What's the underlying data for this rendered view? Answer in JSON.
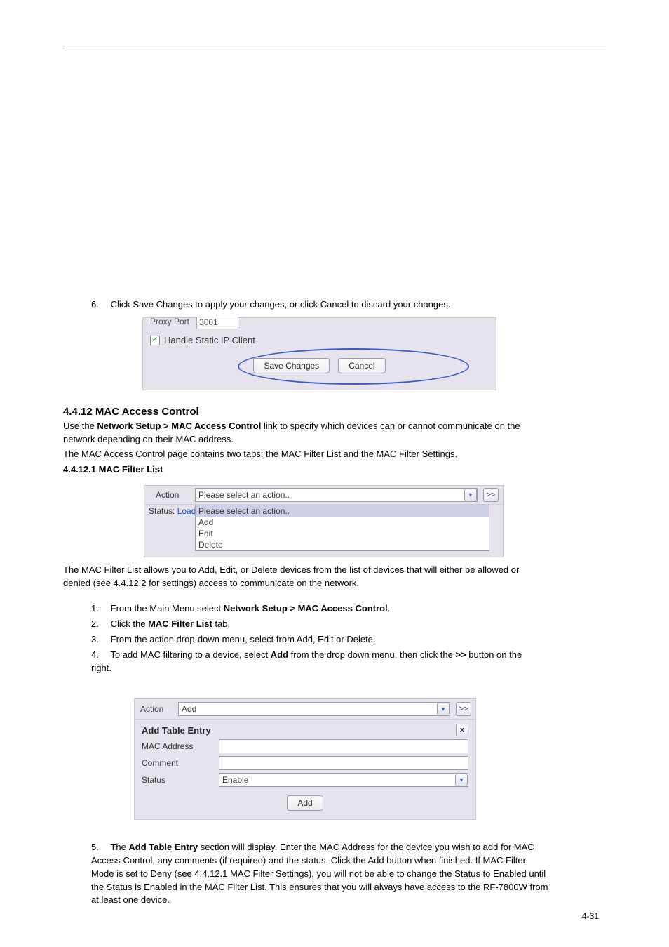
{
  "rule_top": true,
  "section_intro": {
    "heading": "4.4.12 MAC Access Control",
    "title_line_prefix": "Use the ",
    "title_bold": "Network Setup > MAC Access Control",
    "title_line_suffix": " link to specify which devices can or cannot communicate on the network depending on their MAC address."
  },
  "intro2": "The MAC Access Control page contains two tabs: the MAC Filter List and the MAC Filter Settings.",
  "steps": {
    "s6_num": "6.",
    "s6": "Click Save Changes to apply your changes, or click Cancel to discard your changes.",
    "s1_num": "1.",
    "s1_prefix": "From the Main Menu select ",
    "s1_bold": "Network Setup > MAC Access Control",
    "s1_suffix": ".",
    "s2_num": "2.",
    "s2_prefix": "Click the ",
    "s2_bold": "MAC Filter List",
    "s2_suffix": " tab.",
    "s3_num": "3.",
    "s3_text": "From the action drop-down menu, select from Add, Edit or Delete.",
    "s4_num": "4.",
    "s4_prefix": "To add MAC filtering to a device, select ",
    "s4_bold": "Add",
    "s4_mid": " from the drop down menu, then click the ",
    "s4_bold2": ">>",
    "s4_suffix": " button on the right.",
    "s5_num": "5.",
    "s5_prefix": "The ",
    "s5_bold": "Add Table Entry",
    "s5_suffix": " section will display. Enter the MAC Address for the device you wish to add for MAC Access Control, any comments (if required) and the status. Click the Add button when finished. If MAC Filter Mode is set to Deny (see 4.4.12.1 MAC Filter Settings), you will not be able to change the Status to Enabled until the Status is Enabled in the MAC Filter List. This ensures that you will always have access to the RF-7800W from at least one device."
  },
  "sub_heading": "4.4.12.1 MAC Filter List",
  "sub_text": "The MAC Filter List allows you to Add, Edit, or Delete devices from the list of devices that will either be allowed or denied (see 4.4.12.2 for settings) access to communicate on the network.",
  "panel1": {
    "proxy_label": "Proxy Port",
    "proxy_value": "3001",
    "checkbox_label": "Handle Static IP Client",
    "checkbox_checked": true,
    "save_btn": "Save Changes",
    "cancel_btn": "Cancel"
  },
  "panel2": {
    "action_label": "Action",
    "action_selected": "Please select an action..",
    "go_btn": ">>",
    "status_prefix": "Status: ",
    "status_link": "Load",
    "options": {
      "o0": "Please select an action..",
      "o1": "Add",
      "o2": "Edit",
      "o3": "Delete"
    }
  },
  "panel3": {
    "action_label": "Action",
    "action_selected": "Add",
    "go_btn": ">>",
    "add_title": "Add Table Entry",
    "close_label": "x",
    "mac_label": "MAC Address",
    "comment_label": "Comment",
    "status_label": "Status",
    "status_value": "Enable",
    "add_btn": "Add"
  },
  "page_number": "4-31"
}
